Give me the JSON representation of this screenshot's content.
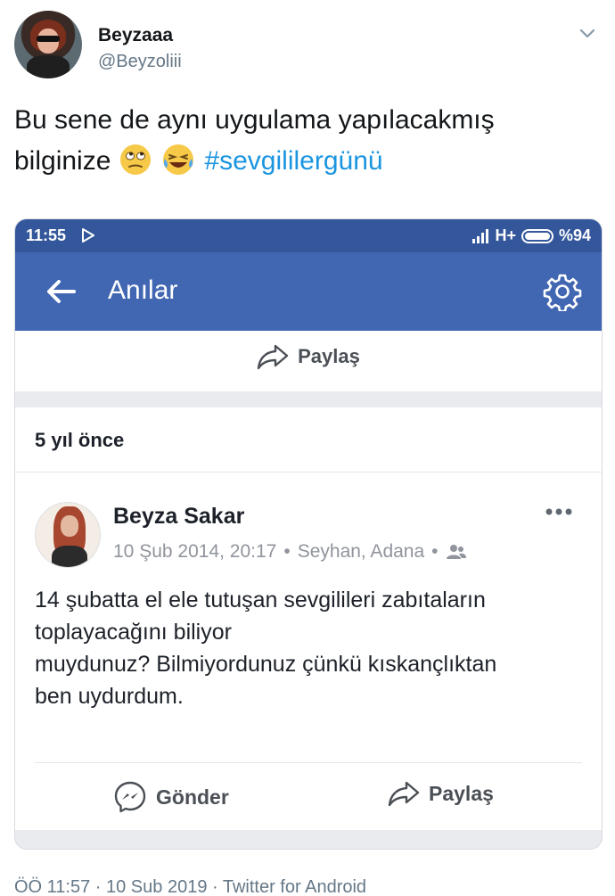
{
  "tweet": {
    "display_name": "Beyzaaa",
    "handle": "@Beyzoliii",
    "text_line1": "Bu sene de aynı uygulama yapılacakmış",
    "text_line2_prefix": "bilginize",
    "hashtag": "#sevgililergünü",
    "emojis": [
      "eye-roll-emoji",
      "laughing-crying-emoji"
    ],
    "footer": "ÖÖ 11:57 · 10 Sub 2019 · Twitter for Android"
  },
  "phone": {
    "status_time": "11:55",
    "network": "H+",
    "battery": "%94",
    "appbar_title": "Anılar",
    "share_label": "Paylaş",
    "years_ago": "5 yıl önce",
    "post": {
      "author": "Beyza Sakar",
      "date": "10 Şub 2014, 20:17",
      "location": "Seyhan, Adana",
      "text_lines": [
        "14 şubatta el ele tutuşan sevgilileri zabıtaların",
        "toplayacağını biliyor",
        "muydunuz? Bilmiyordunuz çünkü kıskançlıktan",
        "ben uydurdum."
      ]
    },
    "send_label": "Gönder",
    "post_share_label": "Paylaş"
  },
  "colors": {
    "statusbar": "#33579a",
    "appbar": "#4267b2",
    "hashtag": "#1b95e0",
    "muted": "#657786"
  }
}
